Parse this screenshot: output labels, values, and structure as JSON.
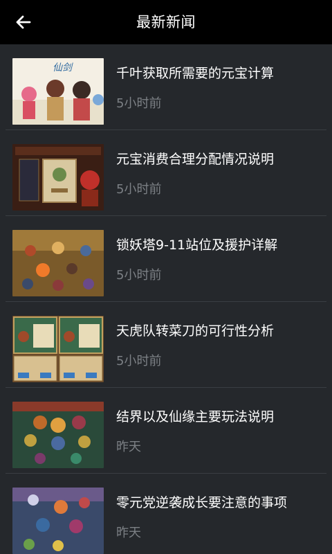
{
  "header": {
    "title": "最新新闻",
    "back_icon": "arrow-left-icon"
  },
  "colors": {
    "header_bg": "#000000",
    "list_bg": "#25282c",
    "title_text": "#ffffff",
    "time_text": "#7c8085",
    "divider": "#3a3e43"
  },
  "news": [
    {
      "title": "千叶获取所需要的元宝计算",
      "time": "5小时前"
    },
    {
      "title": "元宝消费合理分配情况说明",
      "time": "5小时前"
    },
    {
      "title": "锁妖塔9-11站位及援护详解",
      "time": "5小时前"
    },
    {
      "title": "天虎队转菜刀的可行性分析",
      "time": "5小时前"
    },
    {
      "title": "结界以及仙缘主要玩法说明",
      "time": "昨天"
    },
    {
      "title": "零元党逆袭成长要注意的事项",
      "time": "昨天"
    }
  ]
}
